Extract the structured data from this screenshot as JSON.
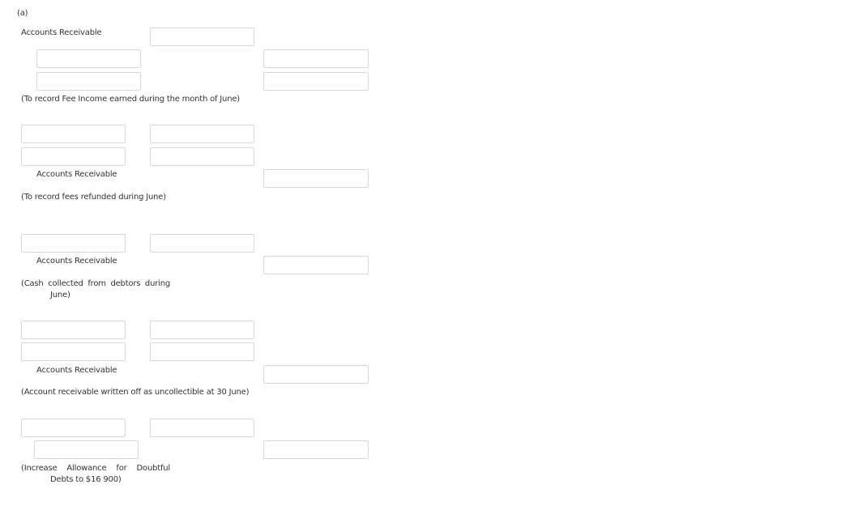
{
  "part_label": "(a)",
  "entries": [
    {
      "debit_account_label": "Accounts Receivable",
      "narration": "(To record Fee Income earned during the month of June)",
      "inputs": {
        "debit_amount": "",
        "credit_account_1": "",
        "credit_account_2": "",
        "credit_amount_1": "",
        "credit_amount_2": ""
      }
    },
    {
      "credit_account_label": "Accounts Receivable",
      "narration": "(To record fees refunded during June)",
      "inputs": {
        "debit_account_1": "",
        "debit_account_2": "",
        "debit_amount_1": "",
        "debit_amount_2": "",
        "credit_amount": ""
      }
    },
    {
      "credit_account_label": "Accounts Receivable",
      "narration": "(Cash collected from debtors during June)",
      "inputs": {
        "debit_account": "",
        "debit_amount": "",
        "credit_amount": ""
      }
    },
    {
      "credit_account_label": "Accounts Receivable",
      "narration": "(Account receivable written off as uncollectible at 30 June)",
      "inputs": {
        "debit_account_1": "",
        "debit_account_2": "",
        "debit_amount_1": "",
        "debit_amount_2": "",
        "credit_amount": ""
      }
    },
    {
      "narration": "(Increase Allowance for Doubtful Debts to $16 900)",
      "inputs": {
        "debit_account": "",
        "debit_amount": "",
        "credit_account": "",
        "credit_amount": ""
      }
    }
  ]
}
